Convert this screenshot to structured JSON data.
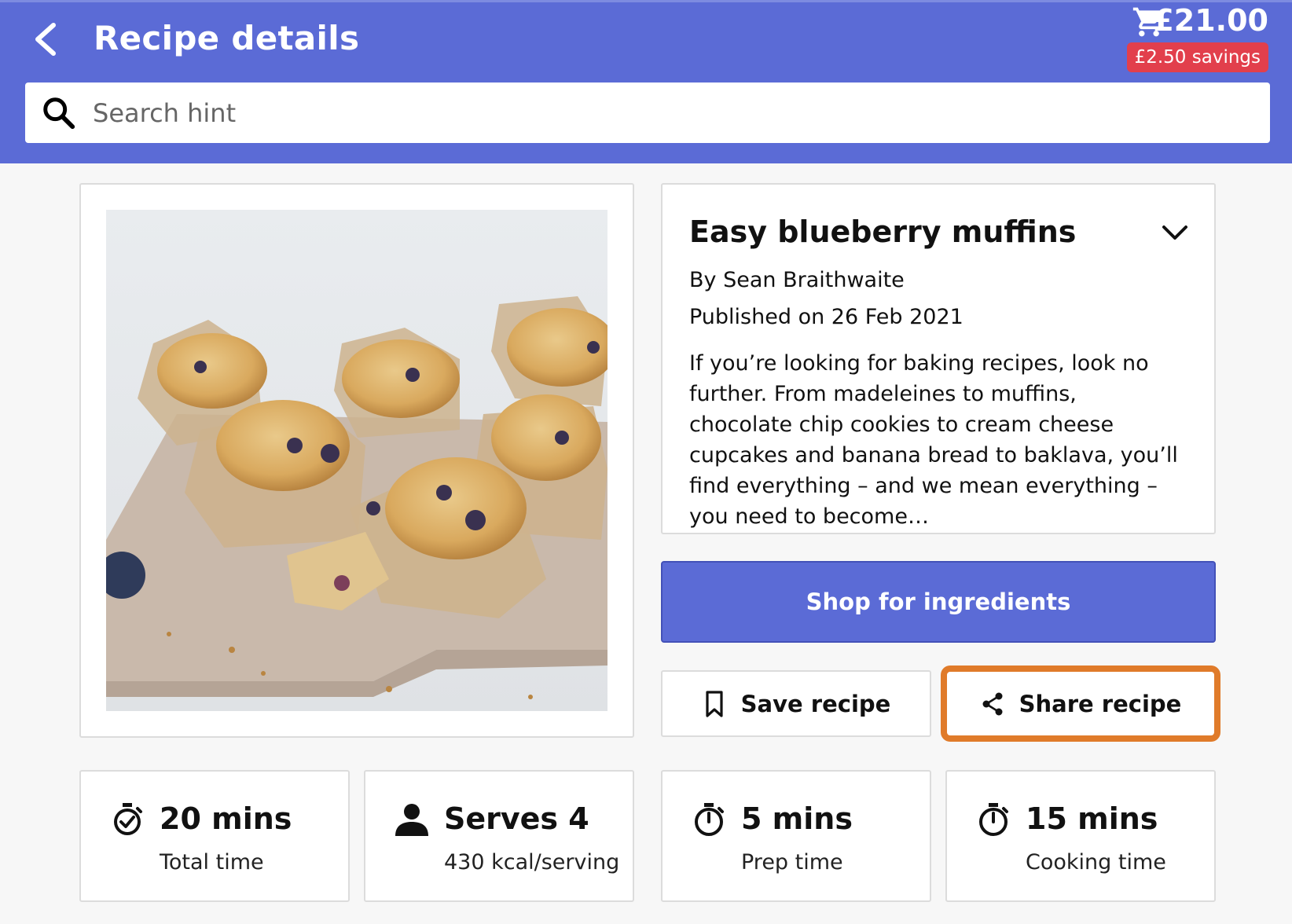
{
  "header": {
    "title": "Recipe details",
    "cart_total": "£21.00",
    "savings": "£2.50 savings"
  },
  "search": {
    "placeholder": "Search hint",
    "value": ""
  },
  "recipe": {
    "title": "Easy blueberry muffins",
    "author": "By Sean Braithwaite",
    "published": "Published on 26 Feb 2021",
    "description": "If you’re looking for baking recipes, look no further. From madeleines to muffins, chocolate chip cookies to cream cheese cupcakes and banana bread to baklava, you’ll find everything – and we mean everything – you need to become…"
  },
  "actions": {
    "shop_label": "Shop for ingredients",
    "save_label": "Save recipe",
    "share_label": "Share recipe"
  },
  "stats": [
    {
      "icon": "stopwatch-check-icon",
      "value": "20 mins",
      "label": "Total time"
    },
    {
      "icon": "person-icon",
      "value": "Serves 4",
      "label": "430 kcal/serving"
    },
    {
      "icon": "timer-icon",
      "value": "5 mins",
      "label": "Prep time"
    },
    {
      "icon": "timer-icon",
      "value": "15 mins",
      "label": "Cooking time"
    }
  ],
  "colors": {
    "header_bg": "#5b6bd6",
    "savings_badge": "#e23f4c",
    "focus_outline": "#e07b2a"
  }
}
